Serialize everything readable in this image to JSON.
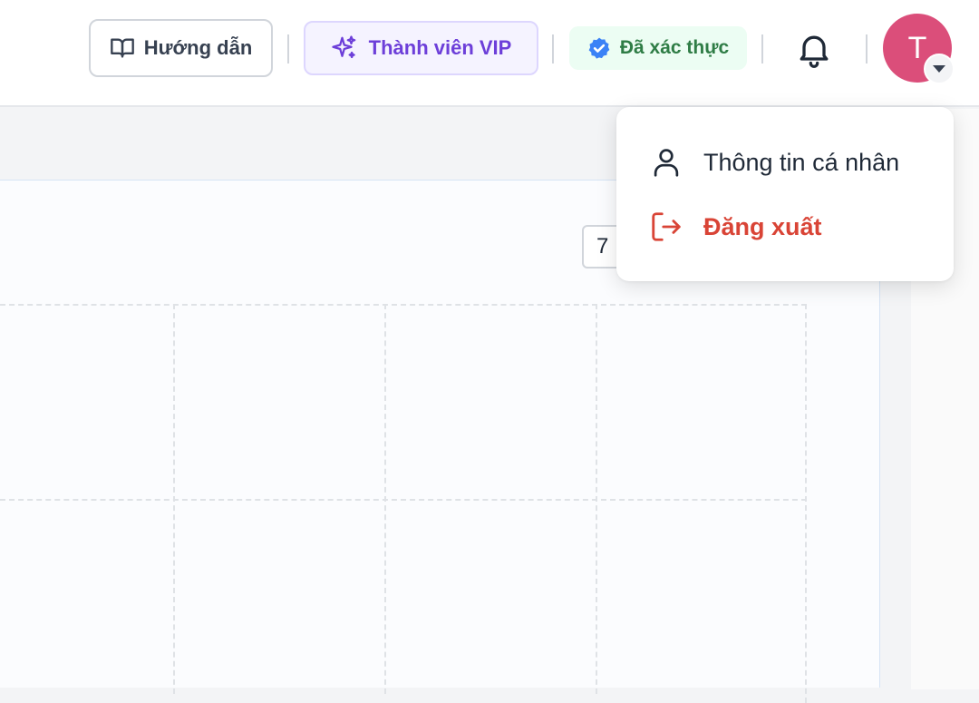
{
  "header": {
    "guide_label": "Hướng dẫn",
    "vip_label": "Thành viên VIP",
    "verified_label": "Đã xác thực",
    "avatar_letter": "T"
  },
  "content": {
    "small_box_value": "7"
  },
  "dropdown": {
    "items": [
      {
        "label": "Thông tin cá nhân",
        "icon": "user-icon"
      },
      {
        "label": "Đăng xuất",
        "icon": "logout-icon"
      }
    ]
  },
  "colors": {
    "vip_accent": "#6d3fd9",
    "verified_green": "#2f7d46",
    "verified_badge_blue": "#3b82f6",
    "avatar_bg": "#db4e7a",
    "logout_red": "#d94436"
  }
}
